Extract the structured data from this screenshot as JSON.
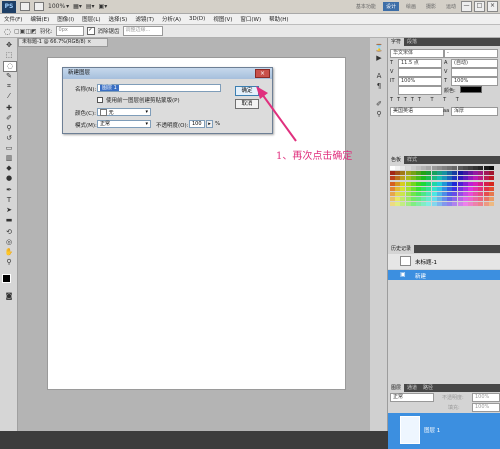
{
  "titlebar": {
    "logo": "PS",
    "zoom": "100%",
    "workspaces": [
      "基本功能",
      "设计",
      "绘画",
      "摄影",
      "运动"
    ],
    "active_workspace": "设计",
    "win_buttons": [
      "—",
      "□",
      "×"
    ]
  },
  "menu": {
    "items": [
      "文件(F)",
      "编辑(E)",
      "图像(I)",
      "图层(L)",
      "选择(S)",
      "滤镜(T)",
      "分析(A)",
      "3D(D)",
      "视图(V)",
      "窗口(W)",
      "帮助(H)"
    ]
  },
  "options": {
    "feather_label": "羽化:",
    "feather_value": "0px",
    "antialias_label": "消除锯齿",
    "refine_label": "调整边缘..."
  },
  "document": {
    "tab_label": "未标题-1 @ 66.7%(RGB/8) ×"
  },
  "dialog": {
    "title": "新建图层",
    "name_label": "名称(N):",
    "name_value": "图层 1",
    "clip_label": "使用前一图层创建剪贴蒙版(P)",
    "color_label": "颜色(C):",
    "color_value": "无",
    "mode_label": "模式(M):",
    "mode_value": "正常",
    "opacity_label": "不透明度(O):",
    "opacity_value": "100",
    "opacity_unit": "%",
    "ok_label": "确定",
    "cancel_label": "取消",
    "close_symbol": "×"
  },
  "annotation": {
    "text": "1、再次点击确定",
    "color": "#e0307e"
  },
  "panels": {
    "char_tabs": [
      "字符",
      "段落"
    ],
    "font_value": "华文宋体",
    "size_value": "11.5 点",
    "leading_value": "(自动)",
    "tracking_value": "100%",
    "scale_value": "100%",
    "color_label": "颜色:",
    "lang_value": "美国英语",
    "aa_value": "浑厚",
    "swatch_tabs": [
      "色板",
      "样式"
    ],
    "history_tabs": [
      "历史记录"
    ],
    "history_items": [
      "未标题-1",
      "新建"
    ],
    "layers_tabs": [
      "图层",
      "通道",
      "路径"
    ],
    "blend_value": "正常",
    "opacity_label": "不透明度:",
    "opacity_value": "100%",
    "fill_label": "填充:",
    "fill_value": "100%",
    "layer_name": "图层 1"
  }
}
